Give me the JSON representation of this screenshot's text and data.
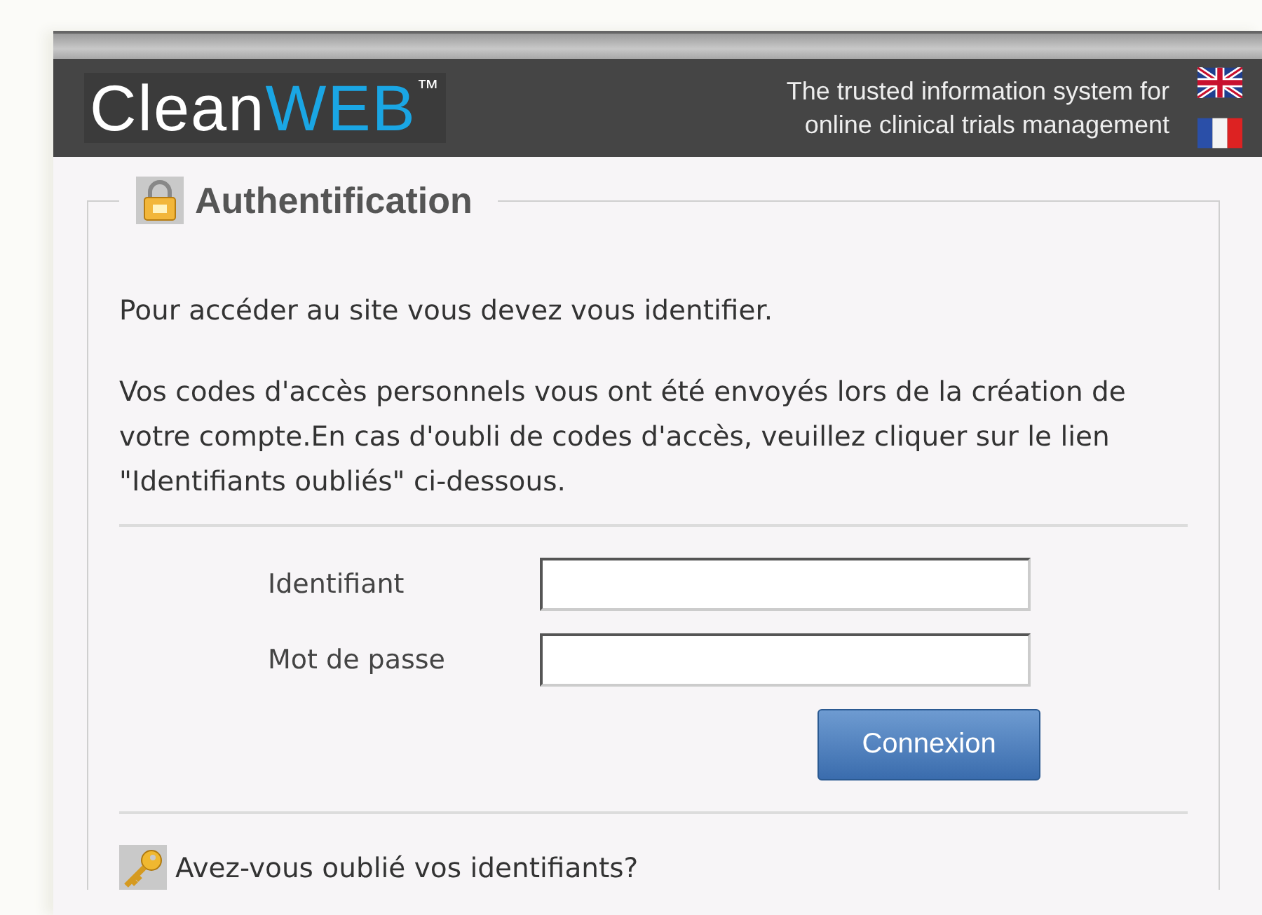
{
  "header": {
    "logo": {
      "text": "Clean",
      "accent": "WEB",
      "mark": "™"
    },
    "tagline": [
      "The trusted information system for",
      "online clinical trials management"
    ]
  },
  "auth": {
    "title": "Authentification",
    "intro": "Pour accéder au site vous devez vous identifier.",
    "info": "Vos codes d'accès personnels vous ont été envoyés lors de la création de votre compte.En cas d'oubli de codes d'accès, veuillez cliquer sur le lien \"Identifiants oubliés\" ci-dessous.",
    "fields": [
      {
        "label": "Identifiant"
      },
      {
        "label": "Mot de passe"
      }
    ],
    "submit": "Connexion",
    "forgot_link": "Avez-vous oublié vos identifiants?"
  }
}
